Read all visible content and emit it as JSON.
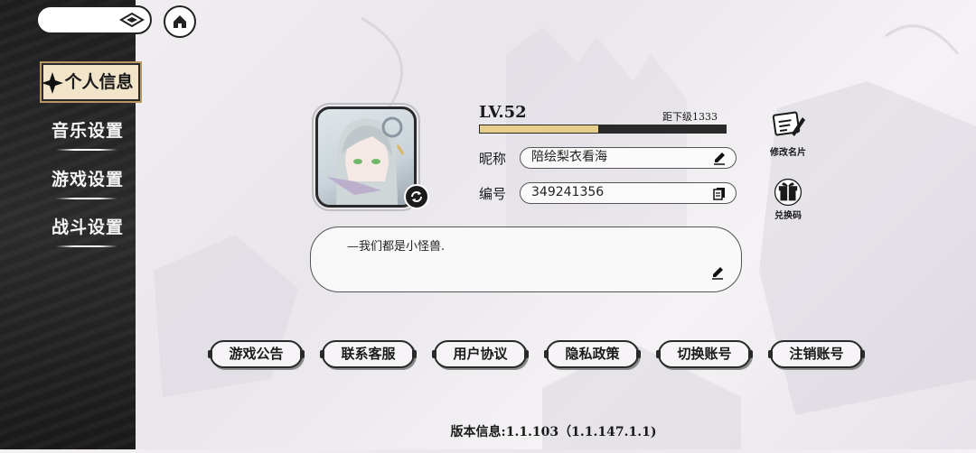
{
  "nav": {
    "items": [
      {
        "label": "个人信息",
        "active": true
      },
      {
        "label": "音乐设置",
        "active": false
      },
      {
        "label": "游戏设置",
        "active": false
      },
      {
        "label": "战斗设置",
        "active": false
      }
    ]
  },
  "top_bar": {
    "back_icon": "diamond-arrow-icon",
    "home_icon": "home-icon"
  },
  "profile": {
    "level": "LV.52",
    "next_level_text": "距下级1333",
    "xp_progress": 0.48,
    "nickname_label": "昵称",
    "nickname": "陪绘梨衣看海",
    "id_label": "编号",
    "id_value": "349241356",
    "signature": "—我们都是小怪兽."
  },
  "side_actions": {
    "edit_card": "修改名片",
    "redeem_code": "兑换码"
  },
  "buttons": [
    "游戏公告",
    "联系客服",
    "用户协议",
    "隐私政策",
    "切换账号",
    "注销账号"
  ],
  "footer": {
    "version": "版本信息:1.1.103（1.1.147.1.1)"
  },
  "colors": {
    "accent_gold": "#e6cf8d",
    "sidebar_dark": "#222222",
    "active_tab_bg": "#f1e4c9"
  }
}
